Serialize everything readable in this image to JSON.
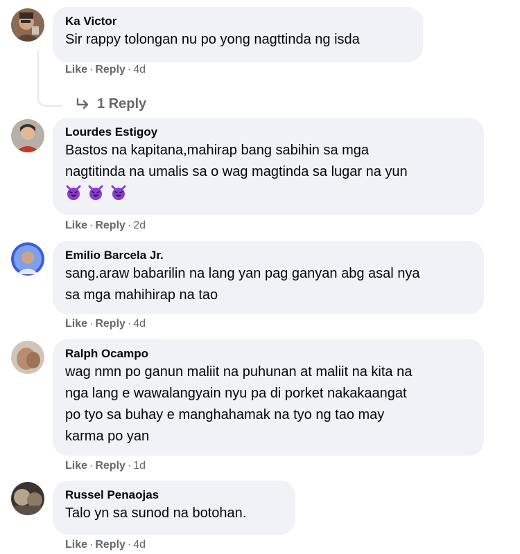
{
  "comments": [
    {
      "author": "Ka Victor",
      "lines": [
        "Sir rappy tolongan nu po yong nagttinda ng isda"
      ],
      "actions": {
        "like": "Like",
        "reply": "Reply",
        "time": "4d"
      },
      "replies_label": "1 Reply",
      "avatar": "profile-photo"
    },
    {
      "author": "Lourdes Estigoy",
      "lines": [
        "Bastos na kapitana,mahirap bang sabihin sa mga",
        "nagtitinda na umalis sa o wag magtinda sa lugar na yun"
      ],
      "emoji": [
        "smiling-devil-emoji",
        "smiling-devil-emoji",
        "smiling-devil-emoji"
      ],
      "actions": {
        "like": "Like",
        "reply": "Reply",
        "time": "2d"
      },
      "avatar": "profile-photo"
    },
    {
      "author": "Emilio Barcela Jr.",
      "lines": [
        "sang.araw babarilin na lang yan pag ganyan abg asal nya",
        "sa mga mahihirap na tao"
      ],
      "actions": {
        "like": "Like",
        "reply": "Reply",
        "time": "4d"
      },
      "avatar": "profile-photo"
    },
    {
      "author": "Ralph Ocampo",
      "lines": [
        "wag nmn po ganun maliit na puhunan at maliit na kita na",
        "nga lang e wawalangyain nyu pa di porket nakakaangat",
        "po tyo sa buhay e manghahamak na tyo ng tao may",
        "karma po yan"
      ],
      "actions": {
        "like": "Like",
        "reply": "Reply",
        "time": "1d"
      },
      "avatar": "profile-photo"
    },
    {
      "author": "Russel Penaojas",
      "lines": [
        "Talo yn sa sunod na botohan."
      ],
      "actions": {
        "like": "Like",
        "reply": "Reply",
        "time": "4d"
      },
      "avatar": "profile-photo"
    }
  ],
  "colors": {
    "bubble": "#f0f2f5",
    "meta": "#65676b",
    "text": "#050505",
    "emoji": "#8a3ccf"
  }
}
